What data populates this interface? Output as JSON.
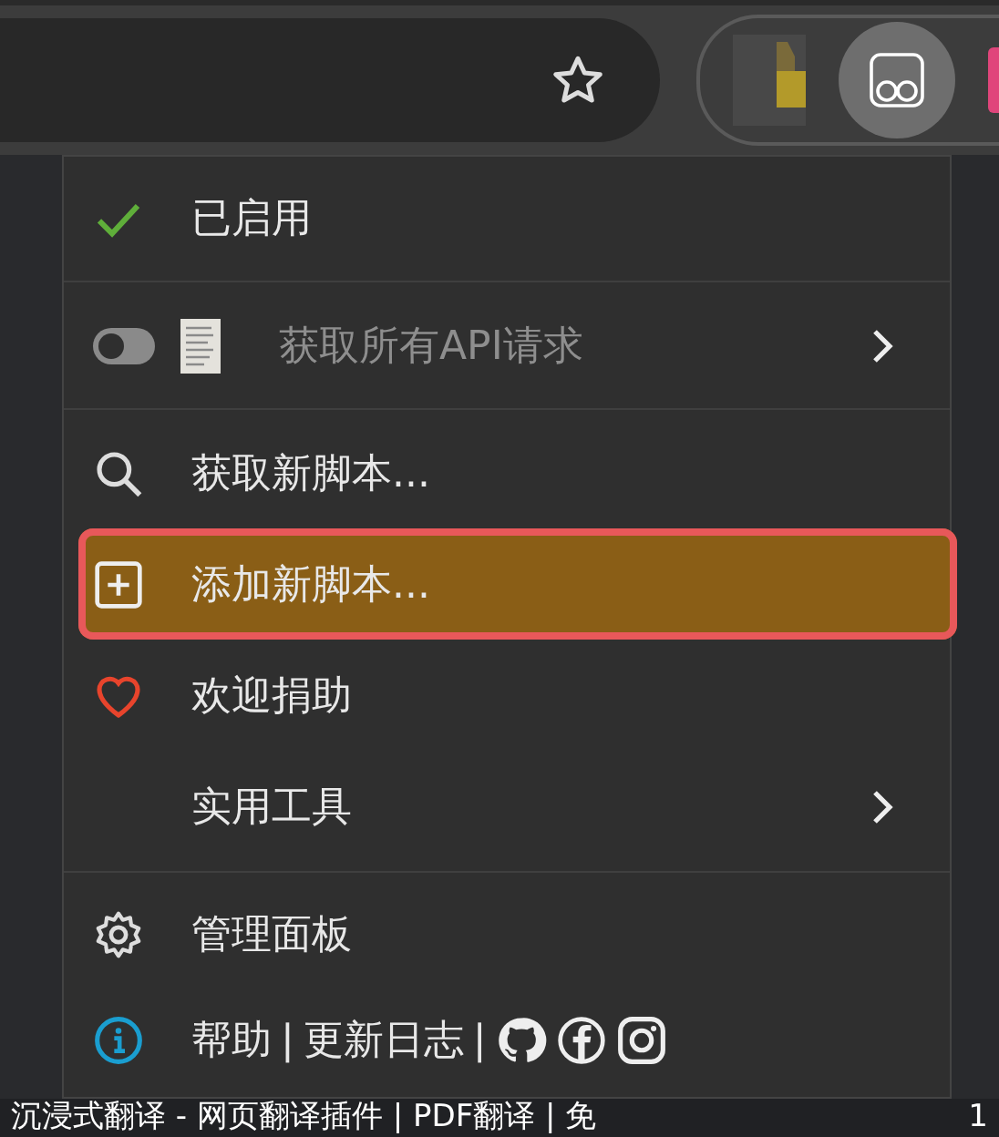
{
  "toolbar": {
    "bookmarked": false,
    "extension_active": true
  },
  "menu": {
    "items": [
      {
        "kind": "check",
        "label": "已启用",
        "checked": true,
        "selected": false,
        "submenu": false,
        "outlined": false
      },
      {
        "kind": "divider"
      },
      {
        "kind": "toggle",
        "label": "获取所有API请求",
        "on": false,
        "disabled": true,
        "selected": false,
        "submenu": true,
        "outlined": false
      },
      {
        "kind": "divider"
      },
      {
        "kind": "search",
        "label": "获取新脚本...",
        "selected": false,
        "submenu": false,
        "outlined": false
      },
      {
        "kind": "add",
        "label": "添加新脚本...",
        "selected": true,
        "submenu": false,
        "outlined": true
      },
      {
        "kind": "heart",
        "label": "欢迎捐助",
        "selected": false,
        "submenu": false,
        "outlined": false
      },
      {
        "kind": "plain",
        "label": "实用工具",
        "selected": false,
        "submenu": true,
        "outlined": false
      },
      {
        "kind": "divider"
      },
      {
        "kind": "gear",
        "label": "管理面板",
        "selected": false,
        "submenu": false,
        "outlined": false
      },
      {
        "kind": "links",
        "parts": [
          {
            "kind": "link",
            "text": "帮助"
          },
          {
            "kind": "sep",
            "text": "|"
          },
          {
            "kind": "link",
            "text": "更新日志"
          },
          {
            "kind": "sep",
            "text": "|"
          },
          {
            "kind": "github"
          },
          {
            "kind": "facebook"
          },
          {
            "kind": "instagram"
          }
        ]
      }
    ]
  },
  "page_title": {
    "text": "沉浸式翻译 - 网页翻译插件 | PDF翻译 | 免",
    "trailing": "1"
  }
}
